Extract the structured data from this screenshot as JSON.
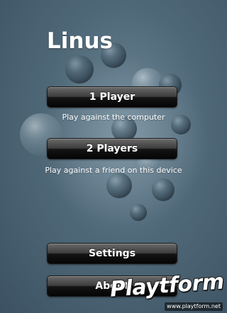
{
  "app": {
    "title": "Linus"
  },
  "menu": {
    "one_player": {
      "label": "1 Player",
      "description": "Play against the computer"
    },
    "two_players": {
      "label": "2 Players",
      "description": "Play against a friend on this device"
    },
    "settings": {
      "label": "Settings"
    },
    "about": {
      "label": "About"
    }
  },
  "watermark": {
    "logo_text": "Playtform",
    "url": "www.playtform.net"
  },
  "colors": {
    "background": "#4f6878",
    "button_top": "#6a6a6a",
    "button_bottom": "#050505",
    "text": "#ffffff"
  }
}
